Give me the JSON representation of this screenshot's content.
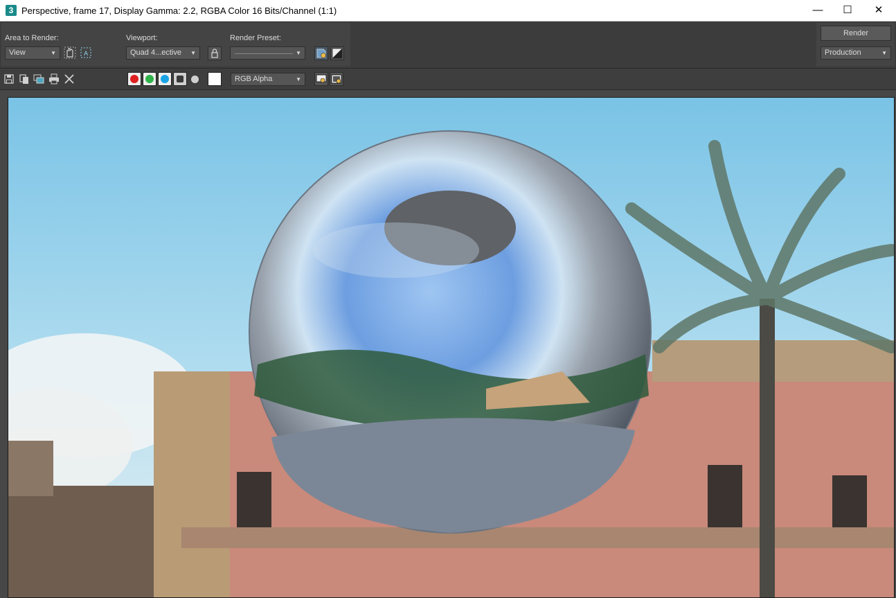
{
  "window": {
    "icon_label": "3",
    "title": "Perspective, frame 17, Display Gamma: 2.2, RGBA Color 16 Bits/Channel (1:1)",
    "controls": {
      "minimize": "—",
      "maximize": "☐",
      "close": "✕"
    }
  },
  "area_to_render": {
    "label": "Area to Render:",
    "value": "View"
  },
  "viewport": {
    "label": "Viewport:",
    "value": "Quad 4...ective"
  },
  "render_preset": {
    "label": "Render Preset:",
    "value": ""
  },
  "render": {
    "button_label": "Render",
    "mode_value": "Production"
  },
  "channel_display": {
    "value": "RGB Alpha"
  },
  "colors": {
    "red": "#e02020",
    "green": "#2fb34a",
    "blue": "#1aa4e6"
  }
}
